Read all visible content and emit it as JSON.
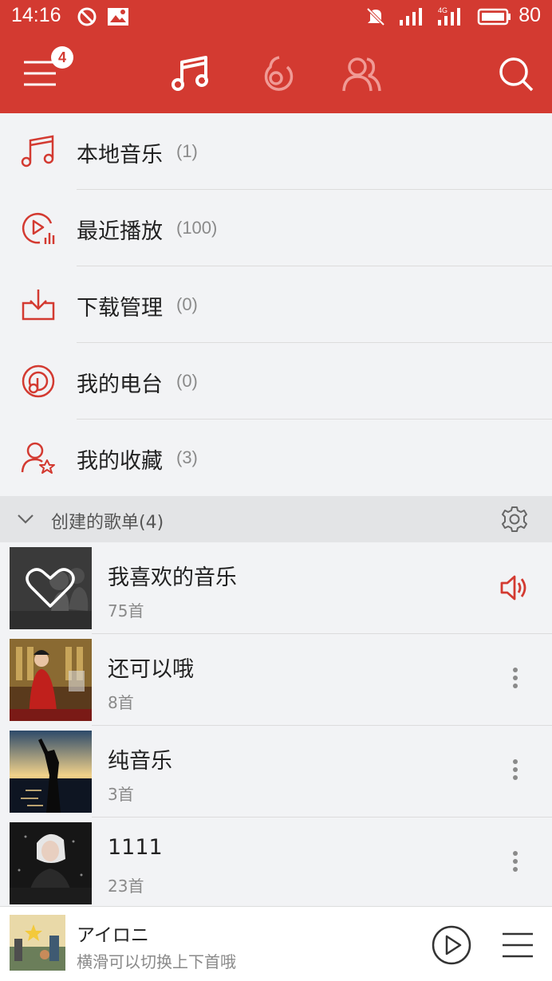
{
  "status_bar": {
    "time": "14:16",
    "battery": "80",
    "network": "4G"
  },
  "top_nav": {
    "badge_count": "4",
    "icons": [
      "menu-icon",
      "music-note-icon",
      "netease-radio-icon",
      "friends-icon",
      "search-icon"
    ]
  },
  "menu": [
    {
      "label": "本地音乐",
      "count": "(1)",
      "icon": "music-note-icon"
    },
    {
      "label": "最近播放",
      "count": "(100)",
      "icon": "recent-play-icon"
    },
    {
      "label": "下载管理",
      "count": "(0)",
      "icon": "download-icon"
    },
    {
      "label": "我的电台",
      "count": "(0)",
      "icon": "radio-icon"
    },
    {
      "label": "我的收藏",
      "count": "(3)",
      "icon": "user-star-icon"
    }
  ],
  "section": {
    "title": "创建的歌单(4)"
  },
  "playlists": [
    {
      "name": "我喜欢的音乐",
      "count": "75首",
      "action": "speaker-icon"
    },
    {
      "name": "还可以哦",
      "count": "8首",
      "action": "more-icon"
    },
    {
      "name": "纯音乐",
      "count": "3首",
      "action": "more-icon"
    },
    {
      "name": "1111",
      "count": "23首",
      "action": "more-icon"
    }
  ],
  "player": {
    "song": "アイロニ",
    "hint": "横滑可以切换上下首哦"
  },
  "colors": {
    "brand": "#d33a31",
    "background": "#f2f3f5",
    "section": "#e3e4e6"
  }
}
